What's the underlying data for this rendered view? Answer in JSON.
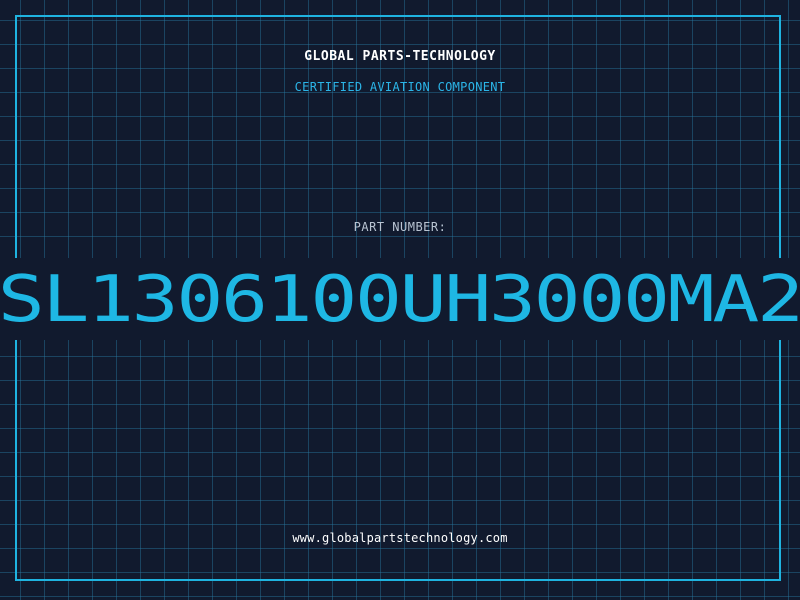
{
  "label": {
    "company": "GLOBAL PARTS-TECHNOLOGY",
    "tagline": "CERTIFIED AVIATION COMPONENT",
    "part_number_label": "PART NUMBER:",
    "part_number": "SL1306100UH3000MA2",
    "website": "www.globalpartstechnology.com"
  },
  "colors": {
    "background": "#111a2e",
    "grid": "#287aa0",
    "accent": "#1eb7e4",
    "title_text": "#ffffff",
    "label_text": "#b9c4d2"
  }
}
